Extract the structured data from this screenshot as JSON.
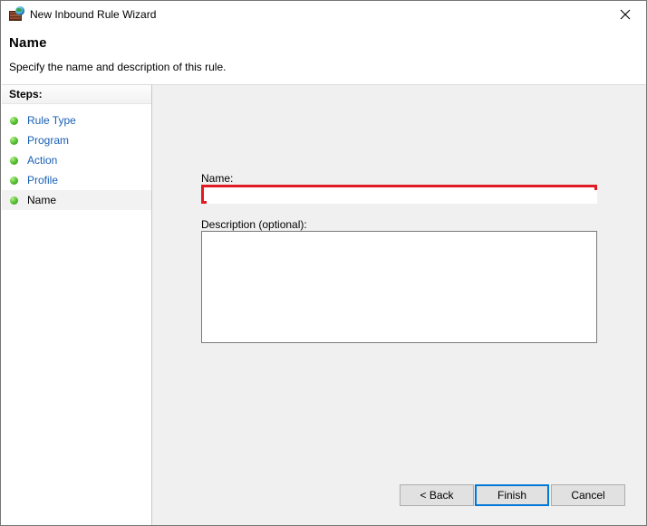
{
  "window": {
    "title": "New Inbound Rule Wizard",
    "icon": "firewall-globe-icon",
    "close_label": "✕"
  },
  "header": {
    "title": "Name",
    "subtitle": "Specify the name and description of this rule."
  },
  "sidebar": {
    "header": "Steps:",
    "items": [
      {
        "label": "Rule Type",
        "state": "completed"
      },
      {
        "label": "Program",
        "state": "completed"
      },
      {
        "label": "Action",
        "state": "completed"
      },
      {
        "label": "Profile",
        "state": "completed"
      },
      {
        "label": "Name",
        "state": "current"
      }
    ]
  },
  "form": {
    "name_label": "Name:",
    "name_value": "",
    "name_placeholder": "",
    "description_label": "Description (optional):",
    "description_value": "",
    "description_placeholder": ""
  },
  "buttons": {
    "back": "< Back",
    "finish": "Finish",
    "cancel": "Cancel"
  },
  "colors": {
    "accent": "#0078d7",
    "highlight": "#e01b24",
    "link": "#1a5fb4",
    "panel": "#f0f0f0",
    "bullet": "#5fc63a"
  }
}
